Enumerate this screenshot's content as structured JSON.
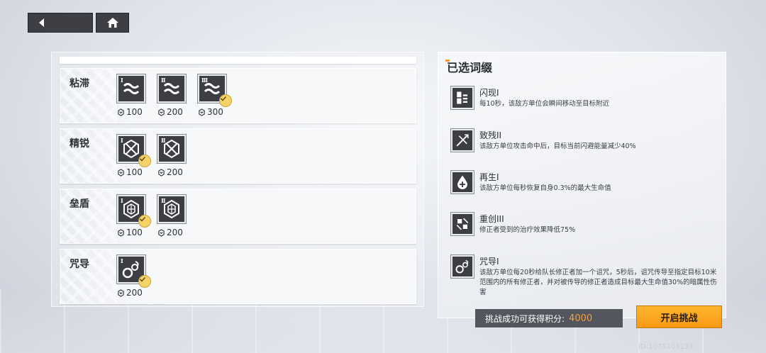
{
  "left": {
    "groups": [
      {
        "title": "粘滞",
        "icon": "wave-icon",
        "affixes": [
          {
            "roman": "I",
            "cost": "100",
            "selected": false
          },
          {
            "roman": "II",
            "cost": "200",
            "selected": false
          },
          {
            "roman": "III",
            "cost": "300",
            "selected": true
          }
        ]
      },
      {
        "title": "精锐",
        "icon": "hex-cross-icon",
        "affixes": [
          {
            "roman": "I",
            "cost": "100",
            "selected": true
          },
          {
            "roman": "II",
            "cost": "200",
            "selected": false
          }
        ]
      },
      {
        "title": "垒盾",
        "icon": "hex-shield-icon",
        "affixes": [
          {
            "roman": "I",
            "cost": "100",
            "selected": true
          },
          {
            "roman": "II",
            "cost": "200",
            "selected": false
          }
        ]
      },
      {
        "title": "咒导",
        "icon": "curse-chain-icon",
        "affixes": [
          {
            "roman": "I",
            "cost": "200",
            "selected": true
          }
        ]
      }
    ]
  },
  "right": {
    "title": "已选词缀",
    "items": [
      {
        "name": "闪现I",
        "desc": "每10秒，该敌方单位会瞬间移动至目标附近",
        "icon": "blink-icon"
      },
      {
        "name": "致残II",
        "desc": "该敌方单位攻击命中后，目标当前闪避能量减少40%",
        "icon": "cripple-icon"
      },
      {
        "name": "再生I",
        "desc": "该敌方单位每秒恢复自身0.3%的最大生命值",
        "icon": "regen-icon"
      },
      {
        "name": "重创III",
        "desc": "修正者受到的治疗效果降低75%",
        "icon": "wound-icon"
      },
      {
        "name": "咒导I",
        "desc": "该敌方单位每20秒给队长修正者加一个诅咒，5秒后，诅咒传导至指定目标10米范围内的所有修正者，并对被传导的修正者造成目标最大生命值30%的暗属性伤害",
        "icon": "curse-chain-icon"
      }
    ]
  },
  "footer": {
    "points_label": "挑战成功可获得积分:",
    "points_value": "4000",
    "start_label": "开启挑战",
    "uid": "ID:1075101134"
  },
  "colors": {
    "accent": "#f89a16",
    "points": "#f3a040",
    "icon_bg": "#3c3e44"
  }
}
